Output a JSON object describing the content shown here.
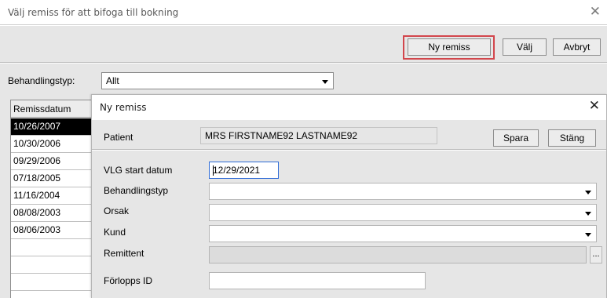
{
  "outer_dialog": {
    "title": "Välj remiss för att bifoga till bokning",
    "close_glyph": "✕",
    "toolbar": {
      "ny_remiss": "Ny remiss",
      "valj": "Välj",
      "avbryt": "Avbryt"
    },
    "filter": {
      "label": "Behandlingstyp:",
      "value": "Allt"
    },
    "table": {
      "header": "Remissdatum",
      "rows": [
        "10/26/2007",
        "10/30/2006",
        "09/29/2006",
        "07/18/2005",
        "11/16/2004",
        "08/08/2003",
        "08/06/2003"
      ],
      "selected_index": 0
    }
  },
  "inner_dialog": {
    "title": "Ny remiss",
    "close_glyph": "✕",
    "patient": {
      "label": "Patient",
      "value": "MRS FIRSTNAME92 LASTNAME92"
    },
    "buttons": {
      "spara": "Spara",
      "stang": "Stäng"
    },
    "form": {
      "vlg_start_datum": {
        "label": "VLG start datum",
        "value": "12/29/2021"
      },
      "behandlingstyp": {
        "label": "Behandlingstyp",
        "value": ""
      },
      "orsak": {
        "label": "Orsak",
        "value": ""
      },
      "kund": {
        "label": "Kund",
        "value": ""
      },
      "remittent": {
        "label": "Remittent",
        "value": "",
        "button": "..."
      },
      "forlopps_id": {
        "label": "Förlopps ID",
        "value": ""
      }
    }
  },
  "colors": {
    "highlight": "#d2464c",
    "selected_row": "#000000",
    "focus_border": "#2e6bd6",
    "panel": "#e6e6e6"
  }
}
